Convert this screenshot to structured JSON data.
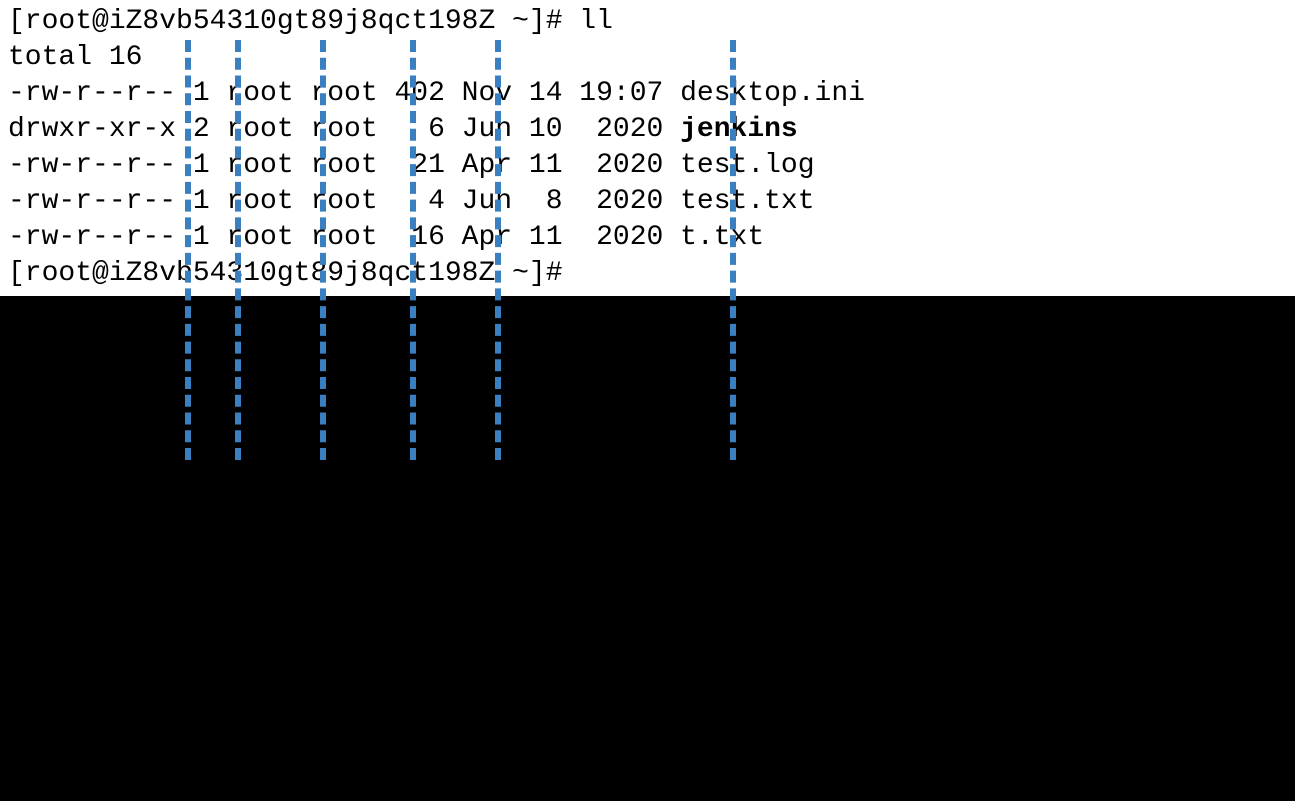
{
  "terminal": {
    "prompt1": "[root@iZ8vb54310gt89j8qct198Z ~]# ll",
    "total": "total 16",
    "rows": [
      {
        "perms": "-rw-r--r--",
        "links": "1",
        "owner": "root",
        "group": "root",
        "size": "402",
        "date": "Nov 14 19:07",
        "name": "desktop.ini",
        "bold": false
      },
      {
        "perms": "drwxr-xr-x",
        "links": "2",
        "owner": "root",
        "group": "root",
        "size": "  6",
        "date": "Jun 10  2020",
        "name": "jenkins",
        "bold": true
      },
      {
        "perms": "-rw-r--r--",
        "links": "1",
        "owner": "root",
        "group": "root",
        "size": " 21",
        "date": "Apr 11  2020",
        "name": "test.log",
        "bold": false
      },
      {
        "perms": "-rw-r--r--",
        "links": "1",
        "owner": "root",
        "group": "root",
        "size": "  4",
        "date": "Jun  8  2020",
        "name": "test.txt",
        "bold": false
      },
      {
        "perms": "-rw-r--r--",
        "links": "1",
        "owner": "root",
        "group": "root",
        "size": " 16",
        "date": "Apr 11  2020",
        "name": "t.txt",
        "bold": false
      }
    ],
    "prompt2": "[root@iZ8vb54310gt89j8qct198Z ~]# "
  },
  "dividers": {
    "positions": [
      185,
      235,
      320,
      410,
      495,
      730
    ]
  }
}
